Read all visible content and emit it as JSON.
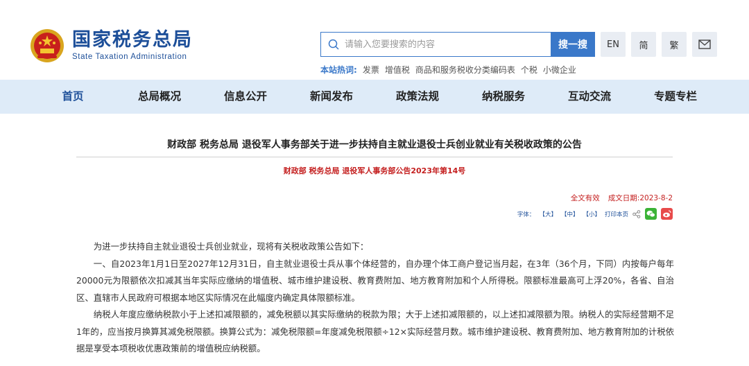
{
  "header": {
    "site_name_cn": "国家税务总局",
    "site_name_en": "State Taxation Administration",
    "search_placeholder": "请输入您要搜索的内容",
    "search_button": "搜一搜",
    "lang_buttons": [
      "EN",
      "简",
      "繁"
    ],
    "hot_label": "本站热词:",
    "hot_words": [
      "发票",
      "增值税",
      "商品和服务税收分类编码表",
      "个税",
      "小微企业"
    ]
  },
  "nav": {
    "items": [
      "首页",
      "总局概况",
      "信息公开",
      "新闻发布",
      "政策法规",
      "纳税服务",
      "互动交流",
      "专题专栏"
    ]
  },
  "article": {
    "title": "财政部  税务总局  退役军人事务部关于进一步扶持自主就业退役士兵创业就业有关税收政策的公告",
    "subtitle": "财政部  税务总局  退役军人事务部公告2023年第14号",
    "validity": "全文有效",
    "date": "成文日期:2023-8-2",
    "font_label": "字体：",
    "font_large": "【大】",
    "font_medium": "【中】",
    "font_small": "【小】",
    "print": "打印本页",
    "paragraphs": [
      "为进一步扶持自主就业退役士兵创业就业，现将有关税收政策公告如下：",
      "一、自2023年1月1日至2027年12月31日，自主就业退役士兵从事个体经营的，自办理个体工商户登记当月起，在3年（36个月，下同）内按每户每年20000元为限额依次扣减其当年实际应缴纳的增值税、城市维护建设税、教育费附加、地方教育附加和个人所得税。限额标准最高可上浮20%，各省、自治区、直辖市人民政府可根据本地区实际情况在此幅度内确定具体限额标准。",
      "纳税人年度应缴纳税款小于上述扣减限额的，减免税额以其实际缴纳的税款为限；大于上述扣减限额的，以上述扣减限额为限。纳税人的实际经营期不足1年的，应当按月换算其减免税限额。换算公式为：减免税限额=年度减免税限额÷12×实际经营月数。城市维护建设税、教育费附加、地方教育附加的计税依据是享受本项税收优惠政策前的增值税应纳税额。"
    ]
  }
}
